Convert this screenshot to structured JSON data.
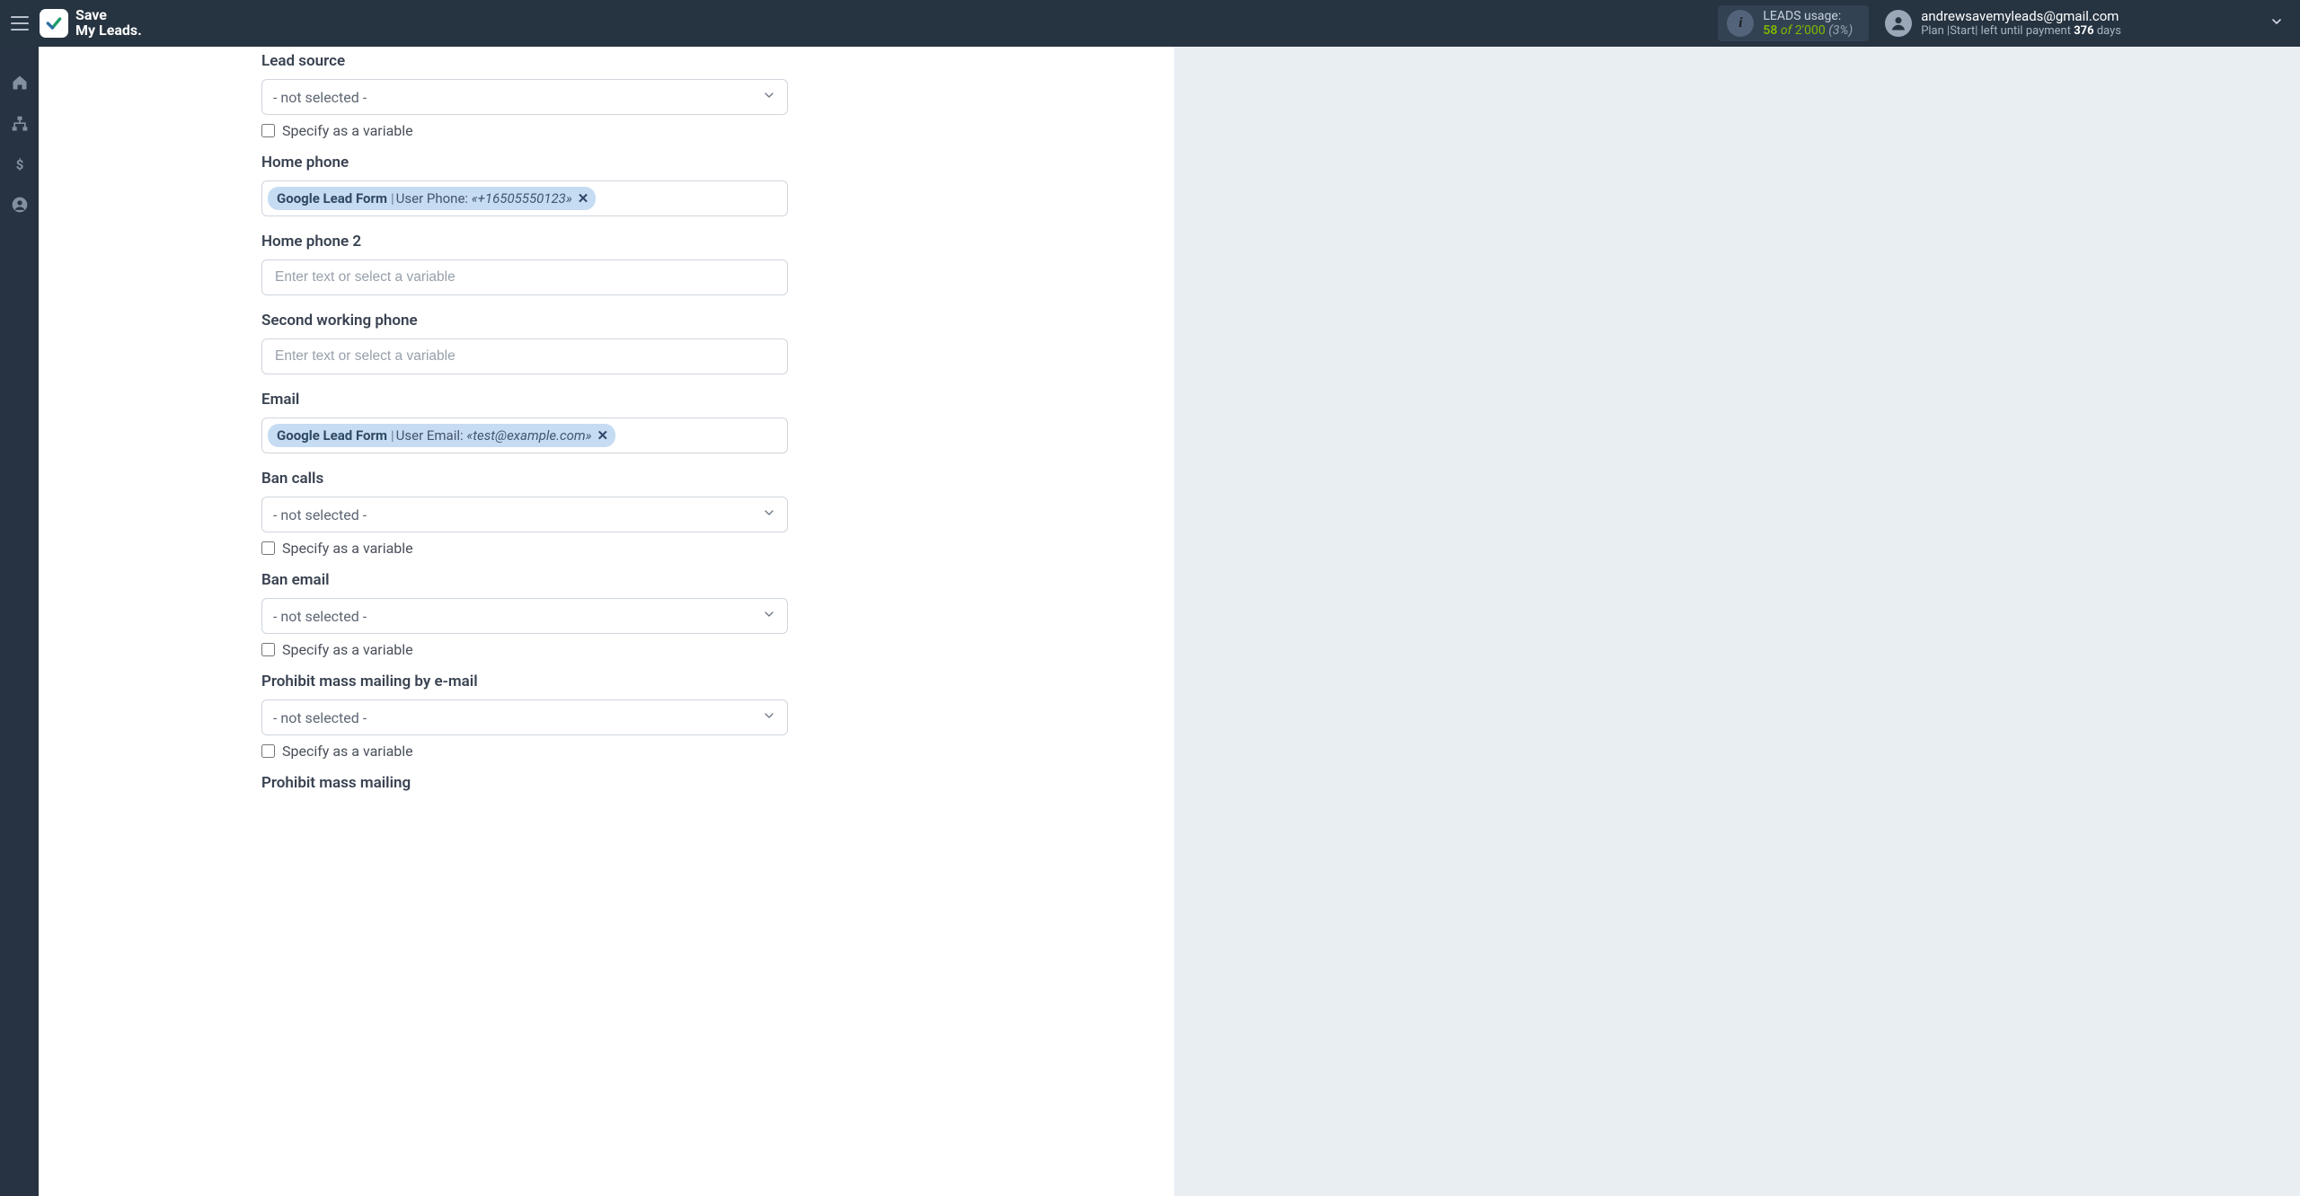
{
  "brand": {
    "line1": "Save",
    "line2": "My Leads."
  },
  "usage": {
    "label": "LEADS usage:",
    "count": "58",
    "of": "of",
    "total": "2'000",
    "pct": "(3%)"
  },
  "user": {
    "email": "andrewsavemyleads@gmail.com",
    "plan_prefix": "Plan |Start| left until payment ",
    "plan_days": "376",
    "plan_suffix": " days"
  },
  "form": {
    "placeholder_text": "Enter text or select a variable",
    "not_selected": "- not selected -",
    "specify_var": "Specify as a variable",
    "lead_source": {
      "label": "Lead source"
    },
    "home_phone": {
      "label": "Home phone",
      "chip_source": "Google Lead Form",
      "chip_field": "User Phone:",
      "chip_sample": "«+16505550123»"
    },
    "home_phone2": {
      "label": "Home phone 2"
    },
    "second_work": {
      "label": "Second working phone"
    },
    "email": {
      "label": "Email",
      "chip_source": "Google Lead Form",
      "chip_field": "User Email:",
      "chip_sample": "«test@example.com»"
    },
    "ban_calls": {
      "label": "Ban calls"
    },
    "ban_email": {
      "label": "Ban email"
    },
    "prohibit_mail": {
      "label": "Prohibit mass mailing by e-mail"
    },
    "prohibit_mass": {
      "label": "Prohibit mass mailing"
    }
  }
}
